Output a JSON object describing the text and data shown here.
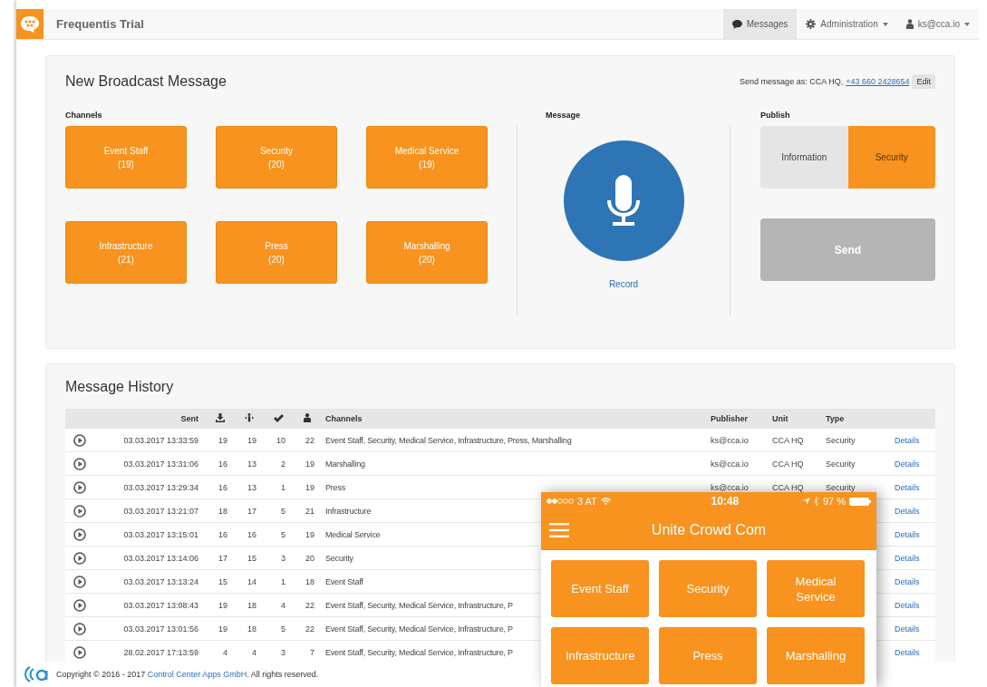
{
  "navbar": {
    "brand": "Frequentis Trial",
    "items": [
      {
        "label": "Messages",
        "kind": "chat",
        "selected": true,
        "dropdown": false
      },
      {
        "label": "Administration",
        "kind": "gear",
        "selected": false,
        "dropdown": true
      },
      {
        "label": "ks@cca.io",
        "kind": "user",
        "selected": false,
        "dropdown": true
      }
    ]
  },
  "broadcast": {
    "title": "New Broadcast Message",
    "send_as_label": "Send message as: CCA HQ,",
    "send_as_phone": "+43 660 2428654",
    "edit_button": "Edit",
    "channels_heading": "Channels",
    "channels": [
      {
        "name": "Event Staff",
        "count": "(19)"
      },
      {
        "name": "Security",
        "count": "(20)"
      },
      {
        "name": "Medical Service",
        "count": "(19)"
      },
      {
        "name": "Infrastructure",
        "count": "(21)"
      },
      {
        "name": "Press",
        "count": "(20)"
      },
      {
        "name": "Marshalling",
        "count": "(20)"
      }
    ],
    "message_heading": "Message",
    "record_label": "Record",
    "publish_heading": "Publish",
    "publish_types": [
      {
        "label": "Information",
        "selected": false
      },
      {
        "label": "Security",
        "selected": true
      }
    ],
    "send_button": "Send"
  },
  "history": {
    "title": "Message History",
    "columns": [
      {
        "kind": "blank"
      },
      {
        "kind": "text",
        "label": "Sent"
      },
      {
        "kind": "download"
      },
      {
        "kind": "people"
      },
      {
        "kind": "check"
      },
      {
        "kind": "person"
      },
      {
        "kind": "text",
        "label": "Channels"
      },
      {
        "kind": "text",
        "label": "Publisher"
      },
      {
        "kind": "text",
        "label": "Unit"
      },
      {
        "kind": "text",
        "label": "Type"
      },
      {
        "kind": "blank"
      }
    ],
    "rows": [
      {
        "sent": "03.03.2017 13:33:59",
        "counts": [
          "19",
          "19",
          "10",
          "22"
        ],
        "channels": "Event Staff, Security, Medical Service, Infrastructure, Press, Marshalling",
        "publisher": "ks@cca.io",
        "unit": "CCA HQ",
        "type": "Security",
        "link": "Details"
      },
      {
        "sent": "03.03.2017 13:31:06",
        "counts": [
          "16",
          "13",
          "2",
          "19"
        ],
        "channels": "Marshalling",
        "publisher": "ks@cca.io",
        "unit": "CCA HQ",
        "type": "Security",
        "link": "Details"
      },
      {
        "sent": "03.03.2017 13:29:34",
        "counts": [
          "16",
          "13",
          "1",
          "19"
        ],
        "channels": "Press",
        "publisher": "ks@cca.io",
        "unit": "CCA HQ",
        "type": "Security",
        "link": "Details"
      },
      {
        "sent": "03.03.2017 13:21:07",
        "counts": [
          "18",
          "17",
          "5",
          "21"
        ],
        "channels": "Infrastructure",
        "link": "Details"
      },
      {
        "sent": "03.03.2017 13:15:01",
        "counts": [
          "16",
          "16",
          "5",
          "19"
        ],
        "channels": "Medical Service",
        "link": "Details"
      },
      {
        "sent": "03.03.2017 13:14:06",
        "counts": [
          "17",
          "15",
          "3",
          "20"
        ],
        "channels": "Security",
        "link": "Details"
      },
      {
        "sent": "03.03.2017 13:13:24",
        "counts": [
          "15",
          "14",
          "1",
          "18"
        ],
        "channels": "Event Staff",
        "link": "Details"
      },
      {
        "sent": "03.03.2017 13:08:43",
        "counts": [
          "19",
          "18",
          "4",
          "22"
        ],
        "channels": "Event Staff, Security, Medical Service, Infrastructure, P",
        "link": "Details"
      },
      {
        "sent": "03.03.2017 13:01:56",
        "counts": [
          "19",
          "18",
          "5",
          "22"
        ],
        "channels": "Event Staff, Security, Medical Service, Infrastructure, P",
        "link": "Details"
      },
      {
        "sent": "28.02.2017 17:13:59",
        "counts": [
          "4",
          "4",
          "3",
          "7"
        ],
        "channels": "Event Staff, Security, Medical Service, Infrastructure, P",
        "link": "Details"
      }
    ]
  },
  "footer": {
    "text_before": "Copyright © 2016 - 2017",
    "link": "Control Center Apps GmbH.",
    "text_after": "All rights reserved."
  },
  "phone": {
    "carrier": "3 AT",
    "time": "10:48",
    "battery": "97 %",
    "title": "Unite Crowd Com",
    "channels": [
      "Event Staff",
      "Security",
      "Medical Service",
      "Infrastructure",
      "Press",
      "Marshalling"
    ]
  }
}
